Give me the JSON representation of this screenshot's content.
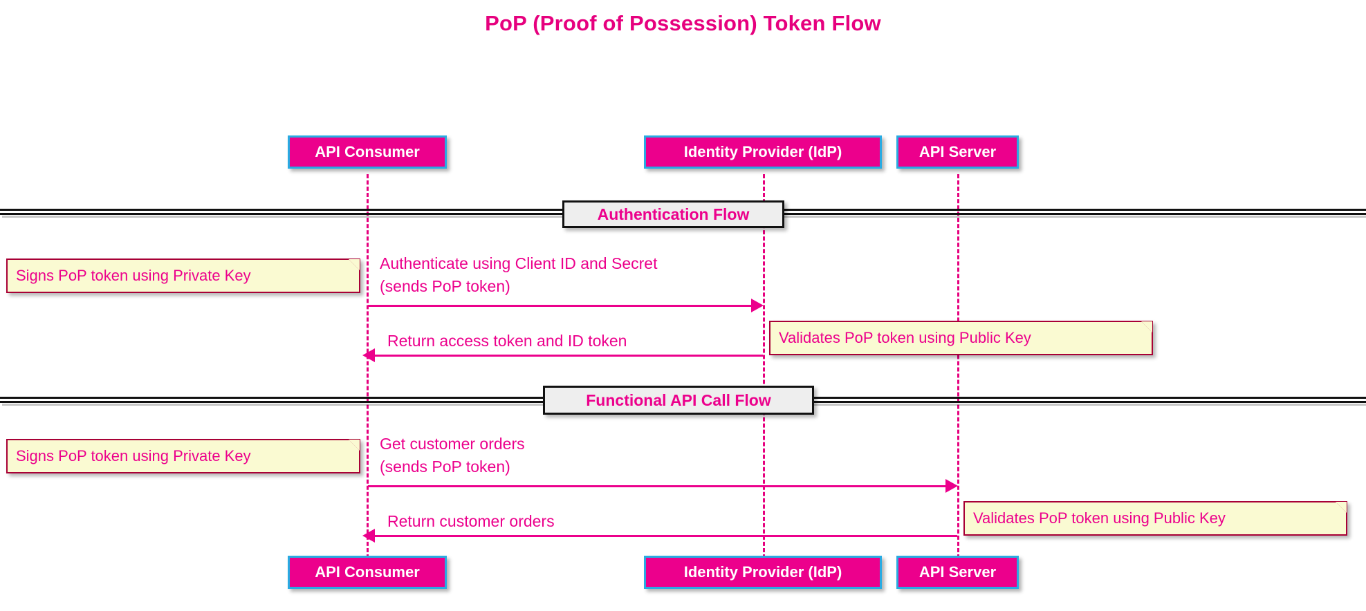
{
  "diagram": {
    "title": "PoP (Proof of Possession) Token Flow",
    "type": "sequence-diagram",
    "colors": {
      "accent_pink": "#EC008C",
      "title_pink": "#E6007E",
      "participant_border_blue": "#29ABE2",
      "note_fill": "#FAFAD2",
      "note_border": "#A80036",
      "divider_fill": "#EEEEEE",
      "divider_border": "#111111",
      "background": "#FFFFFF"
    }
  },
  "participants": [
    {
      "id": "consumer",
      "label": "API Consumer"
    },
    {
      "id": "idp",
      "label": "Identity Provider (IdP)"
    },
    {
      "id": "server",
      "label": "API Server"
    }
  ],
  "participants_bottom": [
    {
      "id": "consumer",
      "label": "API Consumer"
    },
    {
      "id": "idp",
      "label": "Identity Provider (IdP)"
    },
    {
      "id": "server",
      "label": "API Server"
    }
  ],
  "dividers": [
    {
      "id": "auth-flow",
      "label": "Authentication Flow"
    },
    {
      "id": "functional-flow",
      "label": "Functional API Call Flow"
    }
  ],
  "messages": [
    {
      "id": "authenticate",
      "from": "consumer",
      "to": "idp",
      "direction": "right",
      "label_line1": "Authenticate using Client ID and Secret",
      "label_line2": "(sends PoP token)"
    },
    {
      "id": "return-tokens",
      "from": "idp",
      "to": "consumer",
      "direction": "left",
      "label_line1": "Return access token and ID token",
      "label_line2": ""
    },
    {
      "id": "get-customer-orders",
      "from": "consumer",
      "to": "server",
      "direction": "right",
      "label_line1": "Get customer orders",
      "label_line2": "(sends PoP token)"
    },
    {
      "id": "return-customer-orders",
      "from": "server",
      "to": "consumer",
      "direction": "left",
      "label_line1": "Return customer orders",
      "label_line2": ""
    }
  ],
  "notes": [
    {
      "id": "note-sign-auth",
      "side": "left",
      "anchor": "consumer",
      "text": "Signs PoP token using Private Key"
    },
    {
      "id": "note-validate-idp",
      "side": "right",
      "anchor": "idp",
      "text": "Validates PoP token using Public Key"
    },
    {
      "id": "note-sign-api",
      "side": "left",
      "anchor": "consumer",
      "text": "Signs PoP token using Private Key"
    },
    {
      "id": "note-validate-srv",
      "side": "right",
      "anchor": "server",
      "text": "Validates PoP token using Public Key"
    }
  ]
}
